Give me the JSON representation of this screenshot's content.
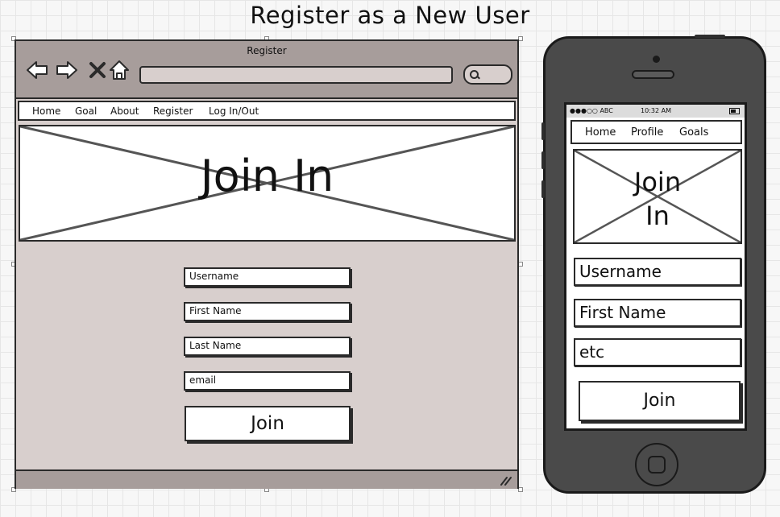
{
  "page_title": "Register as a New User",
  "desktop": {
    "window_title": "Register",
    "menu": [
      "Home",
      "Goal",
      "About",
      "Register",
      "Log In/Out"
    ],
    "banner_text": "Join In",
    "fields": [
      "Username",
      "First Name",
      "Last Name",
      "email"
    ],
    "join_label": "Join"
  },
  "mobile": {
    "carrier": "●●●○○ ABC",
    "time": "10:32 AM",
    "menu": [
      "Home",
      "Profile",
      "Goals"
    ],
    "banner_line1": "Join",
    "banner_line2": "In",
    "fields": [
      "Username",
      "First Name",
      "etc"
    ],
    "join_label": "Join"
  },
  "colors": {
    "window_chrome": "#a79d9b",
    "window_body": "#d8cfcd",
    "phone_body": "#4a4a4a",
    "outline": "#2a2a2a"
  }
}
